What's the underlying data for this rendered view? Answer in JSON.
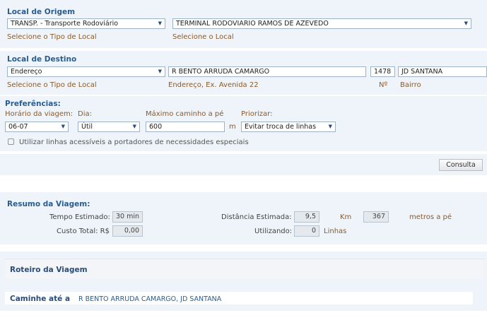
{
  "origem": {
    "title": "Local de Origem",
    "tipo_value": "TRANSP. - Transporte Rodoviário",
    "local_value": "TERMINAL RODOVIARIO RAMOS DE AZEVEDO",
    "hint_tipo": "Selecione o Tipo de Local",
    "hint_local": "Selecione o Local"
  },
  "destino": {
    "title": "Local de Destino",
    "tipo_value": "Endereço",
    "endereco_value": "R  BENTO ARRUDA CAMARGO",
    "numero_value": "1478",
    "bairro_value": "JD SANTANA",
    "hint_tipo": "Selecione o Tipo de Local",
    "hint_endereco": "Endereço, Ex. Avenida 22",
    "hint_numero": "Nº",
    "hint_bairro": "Bairro"
  },
  "preferencias": {
    "title": "Preferências:",
    "horario_label": "Horário da viagem:",
    "horario_value": "06-07",
    "dia_label": "Dia:",
    "dia_value": "Útil",
    "caminho_label": "Máximo caminho a pé",
    "caminho_value": "600",
    "caminho_unit": "m",
    "priorizar_label": "Priorizar:",
    "priorizar_value": "Evitar troca de linhas",
    "acessivel_label": "Utilizar linhas acessíveis a portadores de necessidades especiais"
  },
  "consulta_label": "Consulta",
  "resumo": {
    "title": "Resumo da Viagem:",
    "tempo_label": "Tempo Estimado:",
    "tempo_value": "30 min",
    "custo_label": "Custo Total: R$",
    "custo_value": "0,00",
    "distancia_label": "Distância Estimada:",
    "distancia_value": "9,5",
    "distancia_unit": "Km",
    "metros_value": "367",
    "metros_unit": "metros a pé",
    "utilizando_label": "Utilizando:",
    "utilizando_value": "0",
    "linhas_unit": "Linhas"
  },
  "roteiro": {
    "title": "Roteiro da Viagem",
    "caminhe_label": "Caminhe até a",
    "caminhe_value": "R BENTO ARRUDA CAMARGO, JD SANTANA"
  },
  "colors": {
    "title": "#2a5d8f",
    "hint": "#8a5a2b",
    "band": "#eef4f9"
  }
}
